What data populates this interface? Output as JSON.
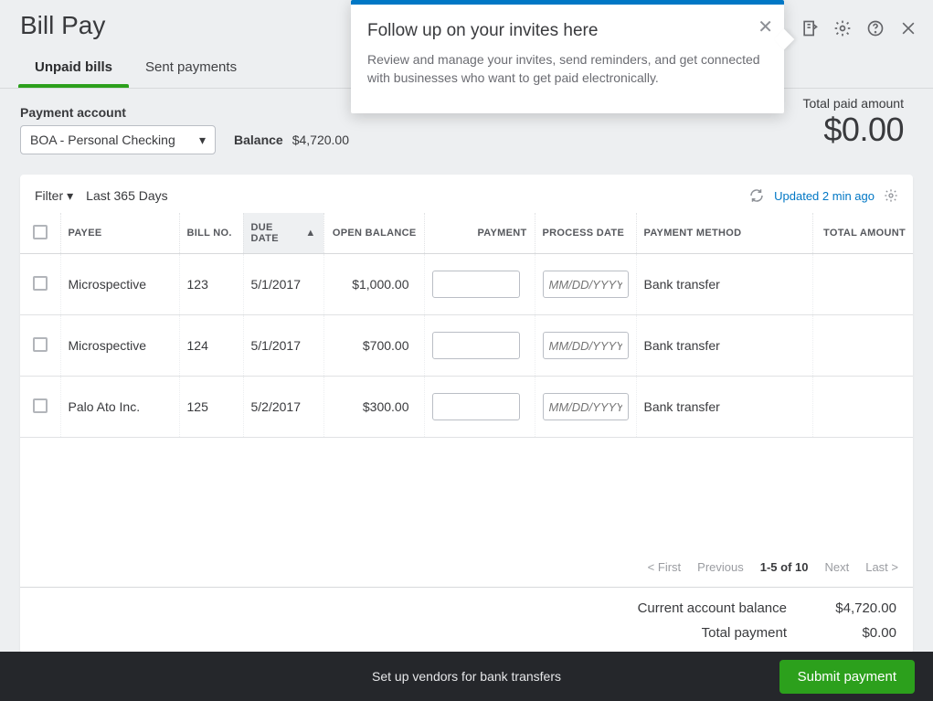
{
  "page_title": "Bill Pay",
  "tabs": [
    {
      "label": "Unpaid bills",
      "active": true
    },
    {
      "label": "Sent payments",
      "active": false
    }
  ],
  "popup": {
    "title": "Follow up on your invites here",
    "body": "Review and manage your invites, send reminders, and get connected with businesses who want to get paid electronically."
  },
  "account": {
    "label": "Payment account",
    "selected": "BOA - Personal Checking",
    "balance_label": "Balance",
    "balance_value": "$4,720.00"
  },
  "totals": {
    "label": "Total paid amount",
    "value": "$0.00"
  },
  "filter": {
    "button": "Filter",
    "range": "Last 365 Days",
    "updated": "Updated 2 min ago"
  },
  "columns": {
    "payee": "PAYEE",
    "bill_no": "BILL NO.",
    "due_date": "DUE DATE",
    "open_balance": "OPEN BALANCE",
    "payment": "PAYMENT",
    "process_date": "PROCESS DATE",
    "payment_method": "PAYMENT METHOD",
    "total_amount": "TOTAL AMOUNT"
  },
  "date_placeholder": "MM/DD/YYYY",
  "rows": [
    {
      "payee": "Microspective",
      "bill_no": "123",
      "due_date": "5/1/2017",
      "open_balance": "$1,000.00",
      "method": "Bank transfer"
    },
    {
      "payee": "Microspective",
      "bill_no": "124",
      "due_date": "5/1/2017",
      "open_balance": "$700.00",
      "method": "Bank transfer"
    },
    {
      "payee": "Palo Ato Inc.",
      "bill_no": "125",
      "due_date": "5/2/2017",
      "open_balance": "$300.00",
      "method": "Bank transfer"
    }
  ],
  "pagination": {
    "first": "< First",
    "previous": "Previous",
    "range": "1-5 of 10",
    "next": "Next",
    "last": "Last >"
  },
  "summary": {
    "balance_label": "Current account balance",
    "balance_value": "$4,720.00",
    "payment_label": "Total payment",
    "payment_value": "$0.00"
  },
  "footer": {
    "setup_link": "Set up vendors for bank transfers",
    "submit": "Submit payment"
  }
}
